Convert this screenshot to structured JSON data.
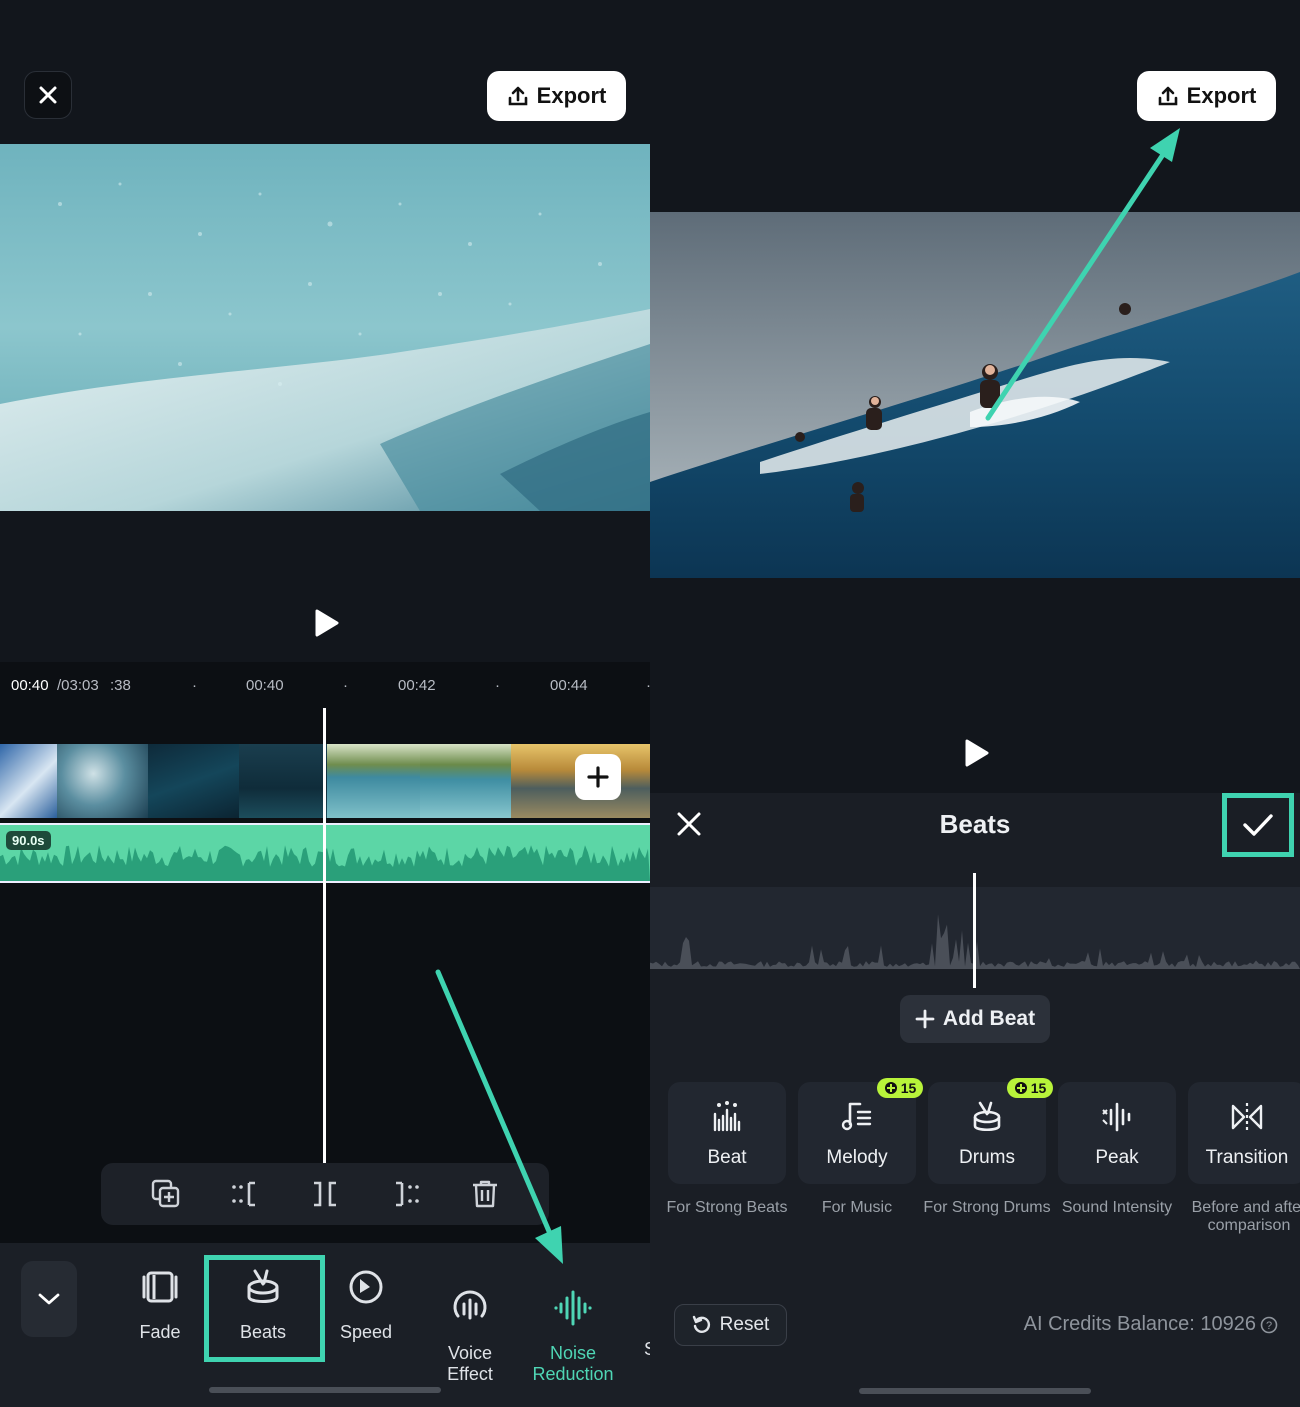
{
  "left": {
    "export_label": "Export",
    "timecode_current": "00:40",
    "timecode_total": "/03:03",
    "ruler_ticks": [
      ":38",
      "00:40",
      "00:42",
      "00:44"
    ],
    "audio_duration": "90.0s",
    "toolbar": [
      {
        "label": "Fade",
        "icon": "fade-icon"
      },
      {
        "label": "Beats",
        "icon": "drum-icon"
      },
      {
        "label": "Speed",
        "icon": "speed-icon"
      },
      {
        "label": "Voice\nEffect",
        "icon": "voice-effect-icon"
      },
      {
        "label": "Noise\nReduction",
        "icon": "noise-reduction-icon"
      }
    ],
    "toolbar_cutoff": "S"
  },
  "right": {
    "export_label": "Export",
    "sheet_title": "Beats",
    "add_beat_label": "Add Beat",
    "options": [
      {
        "label": "Beat",
        "desc": "For Strong Beats",
        "icon": "beat-icon"
      },
      {
        "label": "Melody",
        "desc": "For Music",
        "icon": "melody-icon",
        "credits": "15"
      },
      {
        "label": "Drums",
        "desc": "For Strong Drums",
        "icon": "drum-icon",
        "credits": "15"
      },
      {
        "label": "Peak",
        "desc": "Sound Intensity",
        "icon": "peak-icon"
      },
      {
        "label": "Transition",
        "desc": "Before and after comparison",
        "icon": "transition-icon"
      }
    ],
    "reset_label": "Reset",
    "credits_label": "AI Credits Balance: 10926"
  },
  "colors": {
    "accent": "#3fd3b0",
    "audio_wave": "#5cd6a6",
    "background": "#12161c",
    "credit_badge": "#b8f33a"
  }
}
